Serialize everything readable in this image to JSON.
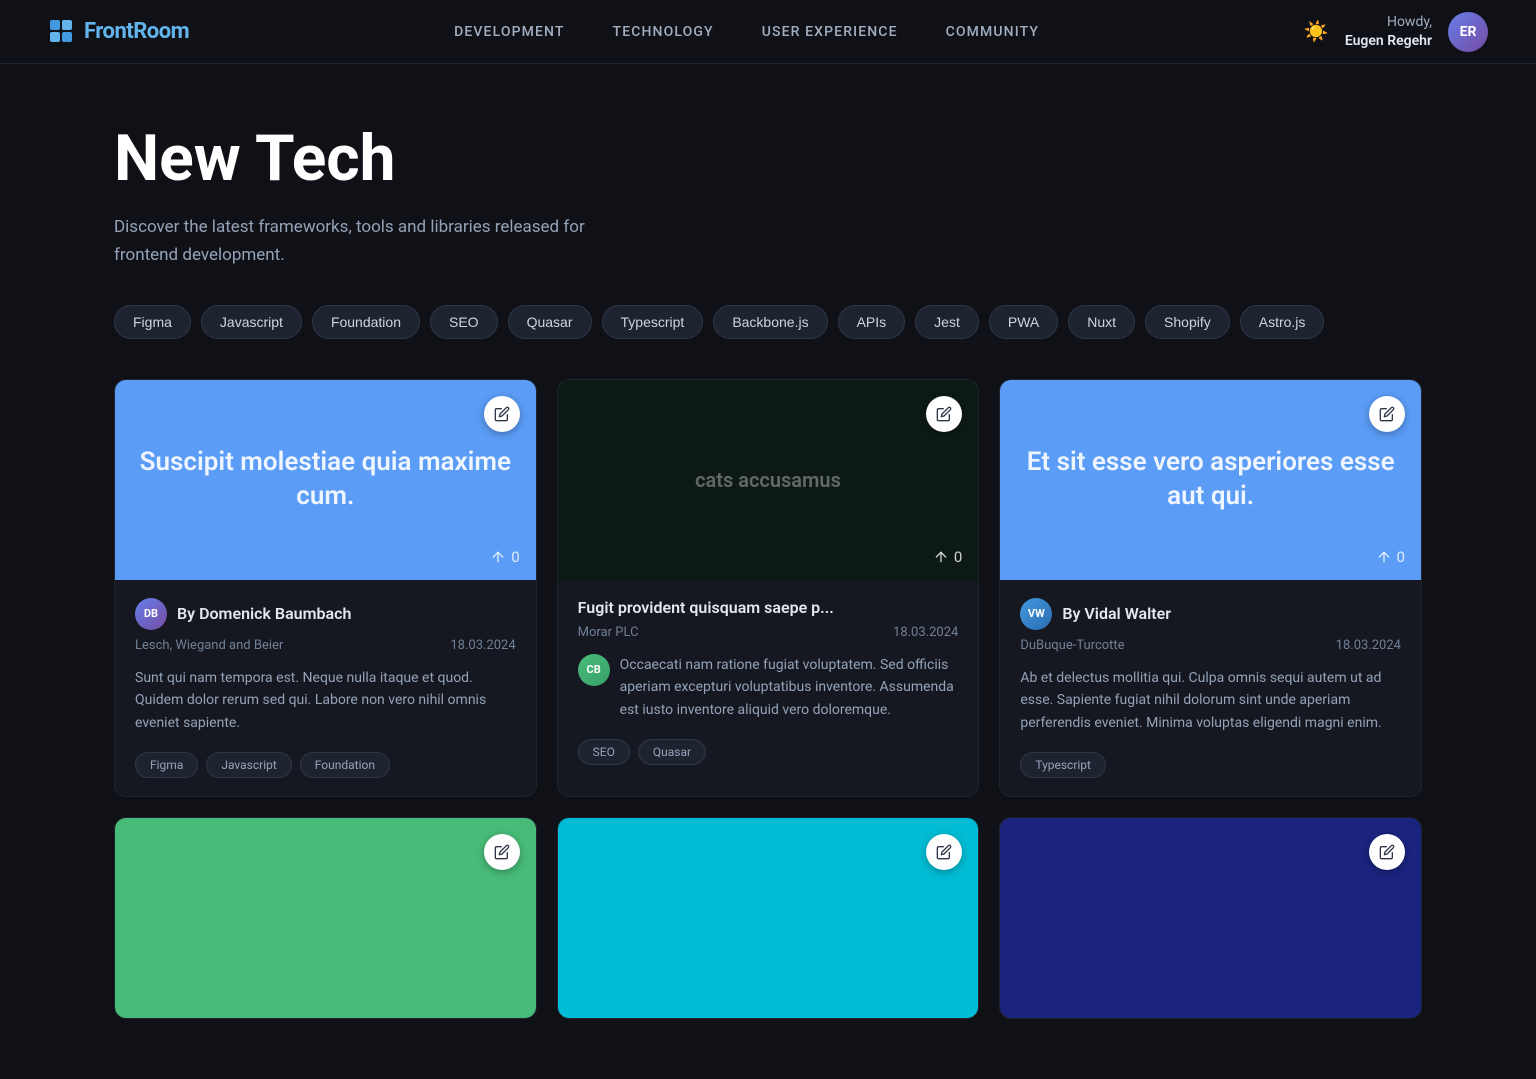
{
  "nav": {
    "logo_text": "FrontRoom",
    "links": [
      {
        "label": "DEVELOPMENT",
        "id": "development"
      },
      {
        "label": "TECHNOLOGY",
        "id": "technology"
      },
      {
        "label": "USER EXPERIENCE",
        "id": "user-experience"
      },
      {
        "label": "COMMUNITY",
        "id": "community"
      }
    ],
    "user_greeting": "Howdy,",
    "user_name": "Eugen Regehr",
    "user_initials": "ER"
  },
  "hero": {
    "title": "New Tech",
    "description": "Discover the latest frameworks, tools and libraries released for frontend development."
  },
  "tags": [
    "Figma",
    "Javascript",
    "Foundation",
    "SEO",
    "Quasar",
    "Typescript",
    "Backbone.js",
    "APIs",
    "Jest",
    "PWA",
    "Nuxt",
    "Shopify",
    "Astro.js"
  ],
  "cards": [
    {
      "id": "card-1",
      "image_bg": "blue-bg",
      "image_text": "Suscipit molestiae quia maxime cum.",
      "image_text_muted": false,
      "votes": "0",
      "has_author": true,
      "author_initials": "DB",
      "author_avatar_class": "av-db",
      "author_label": "By Domenick Baumbach",
      "company": "Lesch, Wiegand and Beier",
      "date": "18.03.2024",
      "description": "Sunt qui nam tempora est. Neque nulla itaque et quod. Quidem dolor rerum sed qui. Labore non vero nihil omnis eveniet sapiente.",
      "has_comment": false,
      "comment_initials": "",
      "comment_avatar_class": "",
      "comment_text": "",
      "tags": [
        "Figma",
        "Javascript",
        "Foundation"
      ]
    },
    {
      "id": "card-2",
      "image_bg": "dark-bg",
      "image_text": "cats accusamus",
      "image_text_muted": true,
      "votes": "0",
      "has_author": false,
      "author_initials": "",
      "author_avatar_class": "",
      "author_label": "Fugit provident quisquam saepe p...",
      "company": "Morar PLC",
      "date": "18.03.2024",
      "description": "",
      "has_comment": true,
      "comment_initials": "CB",
      "comment_avatar_class": "av-cb",
      "comment_text": "Occaecati nam ratione fugiat voluptatem. Sed officiis aperiam excepturi voluptatibus inventore. Assumenda est iusto inventore aliquid vero doloremque.",
      "tags": [
        "SEO",
        "Quasar"
      ]
    },
    {
      "id": "card-3",
      "image_bg": "blue-bg",
      "image_text": "Et sit esse vero asperiores esse aut qui.",
      "image_text_muted": false,
      "votes": "0",
      "has_author": true,
      "author_initials": "VW",
      "author_avatar_class": "av-vw",
      "author_label": "By Vidal Walter",
      "company": "DuBuque-Turcotte",
      "date": "18.03.2024",
      "description": "Ab et delectus mollitia qui. Culpa omnis sequi autem ut ad esse. Sapiente fugiat nihil dolorum sint unde aperiam perferendis eveniet. Minima voluptas eligendi magni enim.",
      "has_comment": false,
      "comment_initials": "",
      "comment_avatar_class": "",
      "comment_text": "",
      "tags": [
        "Typescript"
      ]
    },
    {
      "id": "card-4",
      "image_bg": "green-bg",
      "image_text": "",
      "image_text_muted": false,
      "votes": "",
      "has_author": false,
      "author_initials": "",
      "author_avatar_class": "",
      "author_label": "",
      "company": "",
      "date": "",
      "description": "",
      "has_comment": false,
      "comment_initials": "",
      "comment_avatar_class": "",
      "comment_text": "",
      "tags": []
    },
    {
      "id": "card-5",
      "image_bg": "cyan-bg",
      "image_text": "",
      "image_text_muted": false,
      "votes": "",
      "has_author": false,
      "author_initials": "",
      "author_avatar_class": "",
      "author_label": "",
      "company": "",
      "date": "",
      "description": "",
      "has_comment": false,
      "comment_initials": "",
      "comment_avatar_class": "",
      "comment_text": "",
      "tags": []
    },
    {
      "id": "card-6",
      "image_bg": "navy-bg",
      "image_text": "",
      "image_text_muted": false,
      "votes": "",
      "has_author": false,
      "author_initials": "",
      "author_avatar_class": "",
      "author_label": "",
      "company": "",
      "date": "",
      "description": "",
      "has_comment": false,
      "comment_initials": "",
      "comment_avatar_class": "",
      "comment_text": "",
      "tags": []
    }
  ],
  "colors": {
    "bg_primary": "#0f1117",
    "bg_card": "#151820",
    "accent_blue": "#4299e1",
    "text_primary": "#e2e8f0",
    "text_muted": "#94a3b8"
  }
}
